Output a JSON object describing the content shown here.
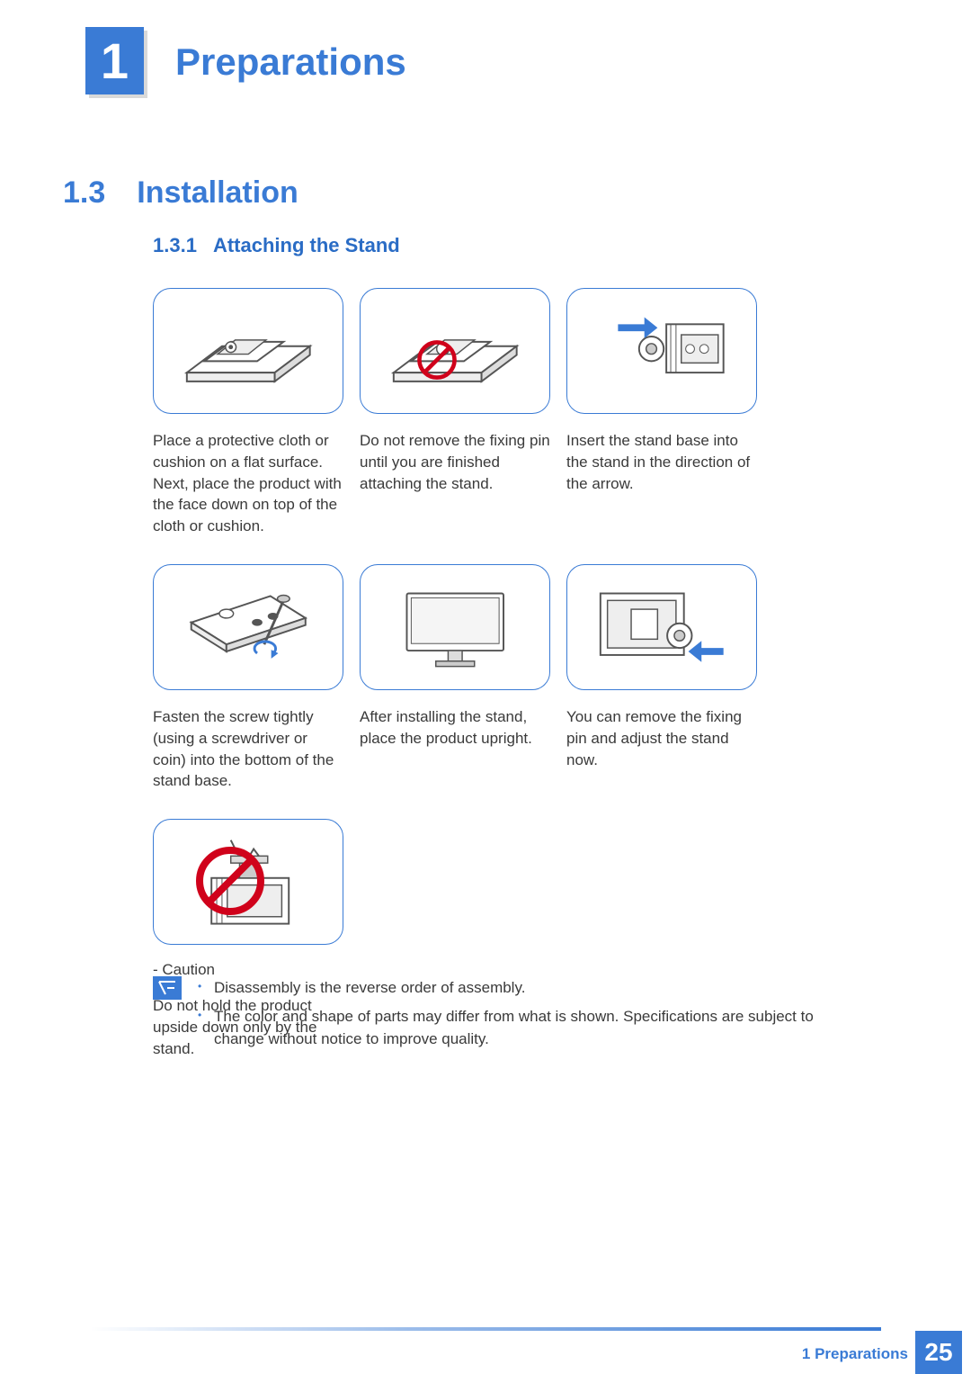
{
  "chapter": {
    "number": "1",
    "title": "Preparations"
  },
  "section": {
    "number": "1.3",
    "title": "Installation"
  },
  "subsection": {
    "number": "1.3.1",
    "title": "Attaching the Stand"
  },
  "steps": [
    {
      "text": "Place a protective cloth or cushion on a flat surface. Next, place the product with the face down on top of the cloth or cushion."
    },
    {
      "text": "Do not remove the fixing pin until you are finished attaching the stand."
    },
    {
      "text": "Insert the stand base into the stand in the direction of the arrow."
    },
    {
      "text": "Fasten the screw tightly (using a screwdriver or coin) into the bottom of the stand base."
    },
    {
      "text": "After installing the stand, place the product upright."
    },
    {
      "text": "You can remove the fixing pin and adjust the stand now."
    },
    {
      "caution": "- Caution",
      "text": "Do not hold the product upside down only by the stand."
    }
  ],
  "notes": [
    "Disassembly is the reverse order of assembly.",
    "The color and shape of parts may differ from what is shown. Specifications are subject to change without notice to improve quality."
  ],
  "footer": {
    "section_label": "1 Preparations",
    "page": "25"
  }
}
